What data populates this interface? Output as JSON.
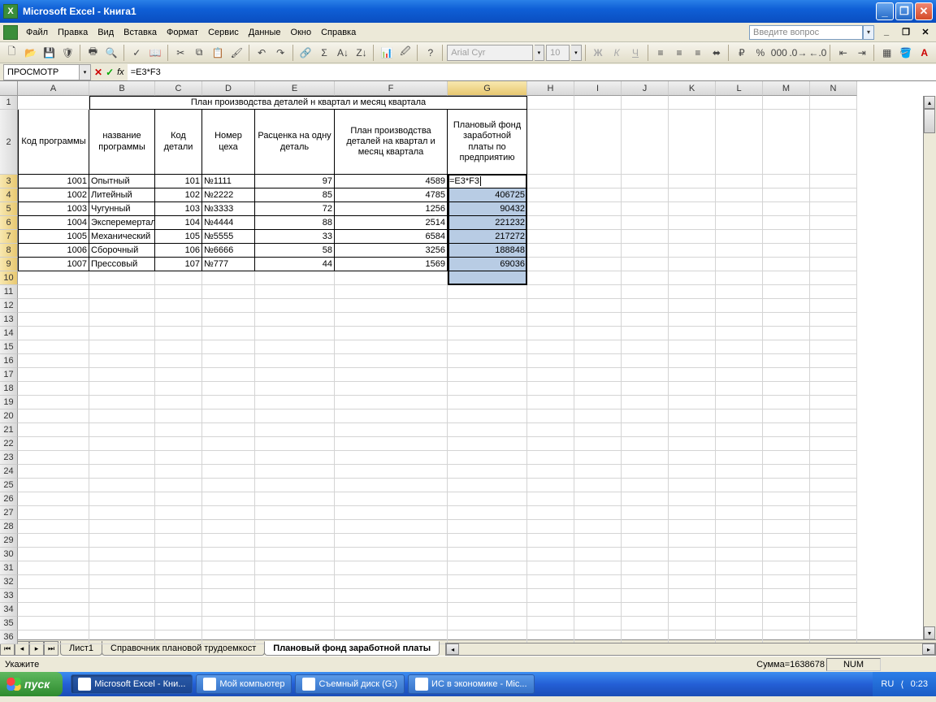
{
  "title": "Microsoft Excel - Книга1",
  "menus": [
    "Файл",
    "Правка",
    "Вид",
    "Вставка",
    "Формат",
    "Сервис",
    "Данные",
    "Окно",
    "Справка"
  ],
  "askbox_placeholder": "Введите вопрос",
  "font_name": "Arial Cyr",
  "font_size": "10",
  "namebox": "ПРОСМОТР",
  "formula": "=E3*F3",
  "cols": [
    "A",
    "B",
    "C",
    "D",
    "E",
    "F",
    "G",
    "H",
    "I",
    "J",
    "K",
    "L",
    "M",
    "N"
  ],
  "merged_title": "План производства деталей н квартал и месяц квартала",
  "headers": {
    "A": "Код программы",
    "B": "название программы",
    "C": "Код детали",
    "D": "Номер цеха",
    "E": "Расценка на одну деталь",
    "F": "План производства деталей на квартал и месяц квартала",
    "G": "Плановый фонд заработной платы по предприятию"
  },
  "rows": [
    {
      "A": "1001",
      "B": "Опытный",
      "C": "101",
      "D": "№1111",
      "E": "97",
      "F": "4589",
      "G": "=E3*F3"
    },
    {
      "A": "1002",
      "B": "Литейный",
      "C": "102",
      "D": "№2222",
      "E": "85",
      "F": "4785",
      "G": "406725"
    },
    {
      "A": "1003",
      "B": "Чугунный",
      "C": "103",
      "D": "№3333",
      "E": "72",
      "F": "1256",
      "G": "90432"
    },
    {
      "A": "1004",
      "B": "Эксперемертальный",
      "C": "104",
      "D": "№4444",
      "E": "88",
      "F": "2514",
      "G": "221232"
    },
    {
      "A": "1005",
      "B": "Механический",
      "C": "105",
      "D": "№5555",
      "E": "33",
      "F": "6584",
      "G": "217272"
    },
    {
      "A": "1006",
      "B": "Сборочный",
      "C": "106",
      "D": "№6666",
      "E": "58",
      "F": "3256",
      "G": "188848"
    },
    {
      "A": "1007",
      "B": "Прессовый",
      "C": "107",
      "D": "№777",
      "E": "44",
      "F": "1569",
      "G": "69036"
    }
  ],
  "sheet_tabs": [
    "Лист1",
    "Справочник плановой трудоемкост",
    "Плановый фонд заработной платы"
  ],
  "active_tab": 2,
  "status_left": "Укажите",
  "status_sum": "Сумма=1638678",
  "status_num": "NUM",
  "start_label": "пуск",
  "task_buttons": [
    {
      "label": "Microsoft Excel - Кни...",
      "active": true
    },
    {
      "label": "Мой компьютер",
      "active": false
    },
    {
      "label": "Съемный диск (G:)",
      "active": false
    },
    {
      "label": "ИС в экономике - Mic...",
      "active": false
    }
  ],
  "tray_lang": "RU",
  "tray_time": "0:23"
}
